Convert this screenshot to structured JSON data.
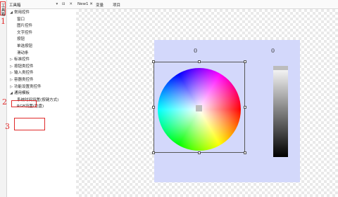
{
  "strip": {
    "label": "工具箱"
  },
  "panel": {
    "title": "工具箱",
    "controls": "▾ ⊟ ✕"
  },
  "tree": [
    {
      "label": "常用控件",
      "expanded": true,
      "level": 0
    },
    {
      "label": "窗口",
      "level": 1
    },
    {
      "label": "图片控件",
      "level": 1
    },
    {
      "label": "文字控件",
      "level": 1
    },
    {
      "label": "按钮",
      "level": 1
    },
    {
      "label": "单选按钮",
      "level": 1
    },
    {
      "label": "滑动条",
      "level": 1
    },
    {
      "label": "标准控件",
      "expanded": false,
      "level": 0
    },
    {
      "label": "按钮类控件",
      "expanded": false,
      "level": 0
    },
    {
      "label": "输入类控件",
      "expanded": false,
      "level": 0
    },
    {
      "label": "容器类控件",
      "expanded": false,
      "level": 0
    },
    {
      "label": "功能设置类控件",
      "expanded": false,
      "level": 0
    },
    {
      "label": "通用模板",
      "expanded": true,
      "level": 0
    },
    {
      "label": "系统时间设置(按键方式)",
      "level": 1
    },
    {
      "label": "RGB设置(色盘)",
      "level": 1
    }
  ],
  "annotations": [
    "1",
    "2",
    "3"
  ],
  "tabs": [
    {
      "label": "New1 ✕"
    },
    {
      "label": "变量"
    },
    {
      "label": "项目"
    }
  ],
  "canvas": {
    "wheel_value": "0",
    "bar_value": "0"
  }
}
